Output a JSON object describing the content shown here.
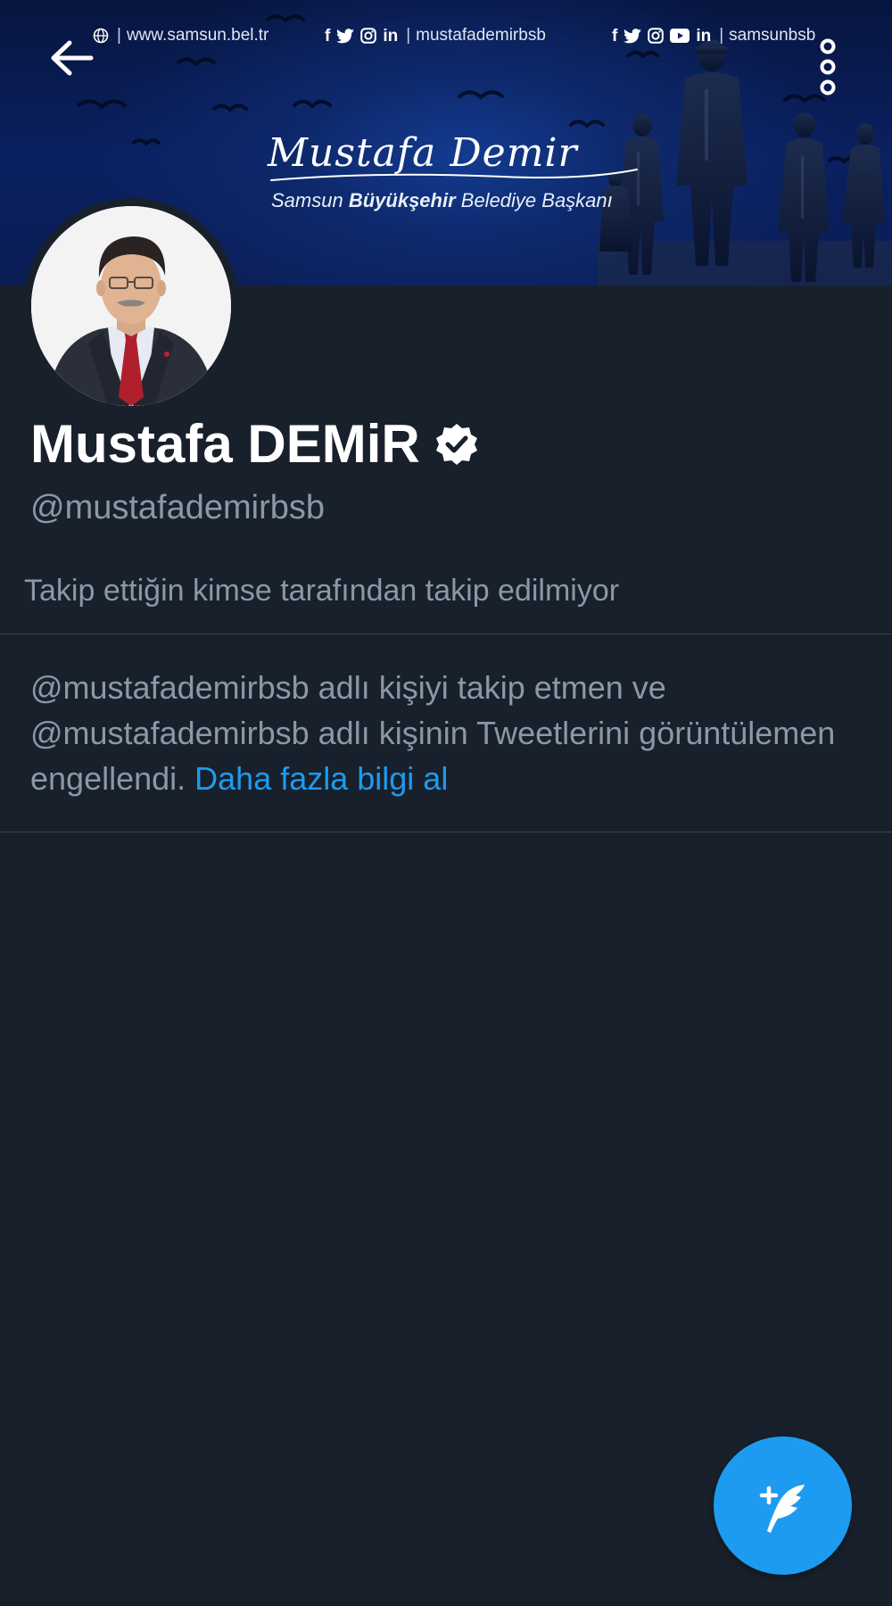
{
  "banner": {
    "website": "www.samsun.bel.tr",
    "social_handle_mid": "mustafademirbsb",
    "social_handle_right": "samsunbsb",
    "signature": "Mustafa Demir",
    "subtitle_pre": "Samsun ",
    "subtitle_bold": "Büyükşehir",
    "subtitle_post": " Belediye Başkanı"
  },
  "header": {
    "back_icon": "arrow-left-icon",
    "more_icon": "more-vertical-icon"
  },
  "profile": {
    "display_name": "Mustafa DEMiR",
    "verified_icon": "verified-badge-icon",
    "handle": "@mustafademirbsb",
    "follow_context": "Takip ettiğin kimse tarafından takip edilmiyor"
  },
  "notice": {
    "text": "@mustafademirbsb adlı kişiyi takip etmen ve @mustafademirbsb adlı kişinin Tweetlerini görüntülemen engellendi. ",
    "link_label": "Daha fazla bilgi al"
  },
  "fab": {
    "icon": "compose-tweet-icon"
  },
  "colors": {
    "background": "#18202b",
    "accent": "#1d9bf0",
    "secondary_text": "#8b98a5",
    "divider": "#38444d",
    "banner": "#0a2060"
  }
}
